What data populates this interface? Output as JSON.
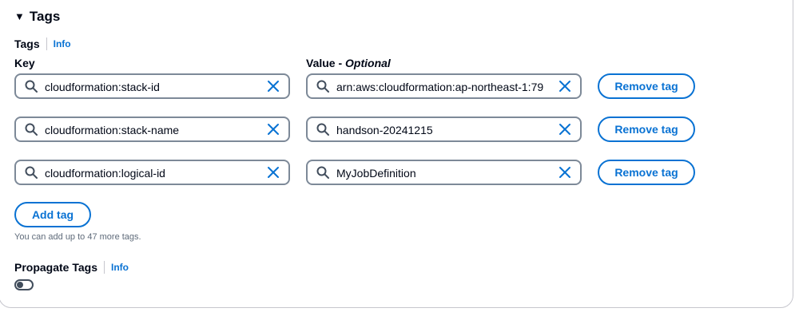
{
  "section": {
    "title": "Tags"
  },
  "tags_field": {
    "label": "Tags",
    "info": "Info"
  },
  "columns": {
    "key": "Key",
    "value_prefix": "Value - ",
    "value_optional": "Optional"
  },
  "tags": [
    {
      "key": "cloudformation:stack-id",
      "value": "arn:aws:cloudformation:ap-northeast-1:79",
      "remove": "Remove tag"
    },
    {
      "key": "cloudformation:stack-name",
      "value": "handson-20241215",
      "remove": "Remove tag"
    },
    {
      "key": "cloudformation:logical-id",
      "value": "MyJobDefinition",
      "remove": "Remove tag"
    }
  ],
  "add_tag": "Add tag",
  "hint": "You can add up to 47 more tags.",
  "propagate": {
    "label": "Propagate Tags",
    "info": "Info",
    "enabled": false
  },
  "colors": {
    "accent": "#0972d3",
    "border": "#7d8998",
    "text": "#000716"
  }
}
